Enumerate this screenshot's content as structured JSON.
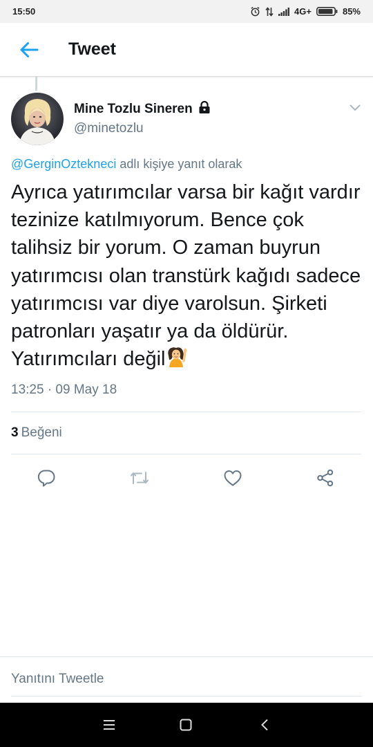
{
  "status_bar": {
    "time": "15:50",
    "network": "4G+",
    "battery": "85%",
    "icons": [
      "alarm-icon",
      "data-arrows-icon",
      "signal-icon",
      "battery-icon"
    ]
  },
  "app_bar": {
    "back_icon": "arrow-left-icon",
    "title": "Tweet"
  },
  "tweet": {
    "author": {
      "name": "Mine Tozlu Sineren",
      "handle": "@minetozlu",
      "protected_icon": "lock-icon"
    },
    "reply_to": {
      "user": "@GerginOztekneci",
      "suffix": " adlı kişiye yanıt olarak"
    },
    "text": "Ayrıca yatırımcılar varsa bir kağıt vardır tezinize katılmıyorum. Bence çok talihsiz bir yorum. O zaman buyrun yatırımcısı olan transtürk kağıdı sadece yatırımcısı var diye varolsun. Şirketi patronları yaşatır ya da öldürür. Yatırımcıları değil",
    "emoji": "person-raising-hand-emoji",
    "timestamp": "13:25 · 09 May 18",
    "likes": {
      "count": "3",
      "label": "Beğeni"
    }
  },
  "actions": [
    "reply-icon",
    "retweet-icon",
    "like-icon",
    "share-icon"
  ],
  "reply_field": {
    "placeholder": "Yanıtını Tweetle"
  },
  "nav_bar": [
    "menu-icon",
    "home-square-icon",
    "back-chevron-icon"
  ],
  "colors": {
    "accent": "#1da1f2",
    "secondary_text": "#657786",
    "primary_text": "#14171a",
    "action_icon": "#657786",
    "retweet_disabled": "#aab8c2"
  }
}
